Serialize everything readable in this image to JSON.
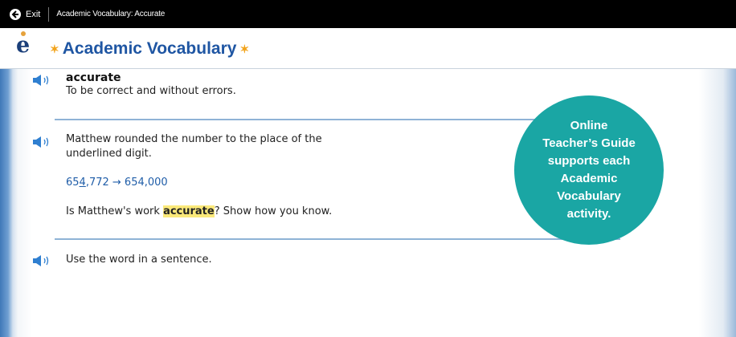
{
  "topbar": {
    "exit_label": "Exit",
    "breadcrumb": "Academic Vocabulary: Accurate"
  },
  "header": {
    "logo_letter": "e",
    "title": "Academic Vocabulary"
  },
  "definition": {
    "word": "accurate",
    "meaning": "To be correct and without errors."
  },
  "question": {
    "prompt_line1": "Matthew rounded the number to the place of the",
    "prompt_line2": "underlined digit.",
    "math_prefix": "65",
    "math_underlined": "4",
    "math_suffix": ",772 → 654,000",
    "ask_before": "Is Matthew's work ",
    "ask_highlight": "accurate",
    "ask_after": "? Show how you know."
  },
  "sentence_prompt": "Use the word in a sentence.",
  "callout": {
    "line1": "Online",
    "line2": "Teacher’s Guide",
    "line3": "supports each",
    "line4": "Academic",
    "line5": "Vocabulary",
    "line6": "activity."
  },
  "colors": {
    "topbar": "#000000",
    "brand_blue": "#1f56a3",
    "star_orange": "#f2a31b",
    "speaker_blue": "#2f7fd0",
    "divider": "#8fb3d6",
    "highlight": "#fbe97a",
    "callout_teal": "#1aa6a4"
  },
  "icons": [
    "arrow-left-circle-icon",
    "speaker-icon",
    "star-icon"
  ]
}
